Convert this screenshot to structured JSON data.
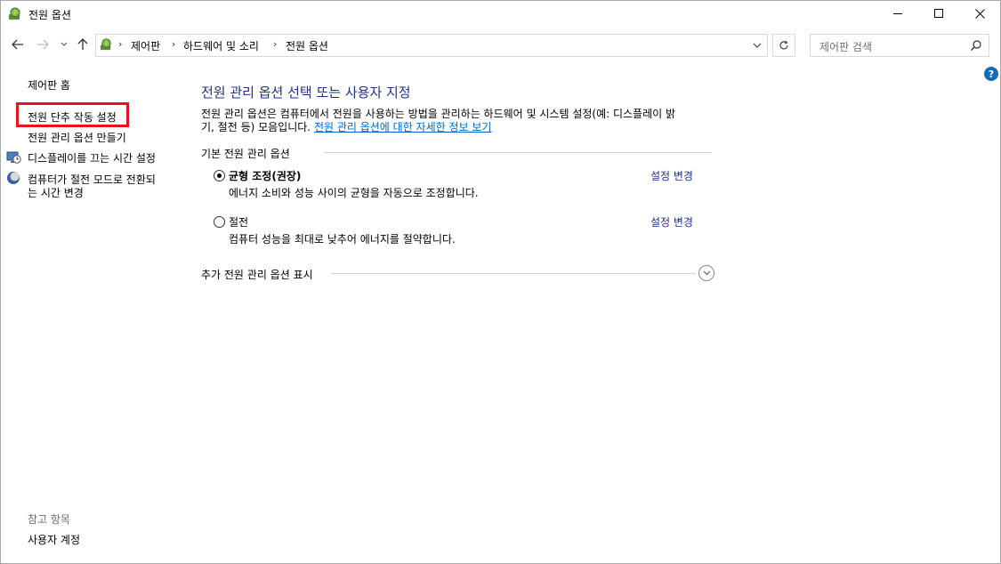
{
  "window": {
    "title": "전원 옵션"
  },
  "nav": {
    "breadcrumb": [
      "제어판",
      "하드웨어 및 소리",
      "전원 옵션"
    ],
    "search_placeholder": "제어판 검색"
  },
  "sidebar": {
    "home": "제어판 홈",
    "links": [
      "전원 단추 작동 설정",
      "전원 관리 옵션 만들기",
      "디스플레이를 끄는 시간 설정",
      "컴퓨터가 절전 모드로 전환되",
      "는 시간 변경"
    ],
    "see_also_heading": "참고 항목",
    "see_also_links": [
      "사용자 계정"
    ]
  },
  "main": {
    "heading": "전원 관리 옵션 선택 또는 사용자 지정",
    "description_line1": "전원 관리 옵션은 컴퓨터에서 전원을 사용하는 방법을 관리하는 하드웨어 및 시스템 설정(예: 디스플레이 밝",
    "description_line2": "기, 절전 등) 모음입니다. ",
    "description_link": "전원 관리 옵션에 대한 자세한 정보 보기",
    "group_label": "기본 전원 관리 옵션",
    "plans": [
      {
        "name": "균형 조정(권장)",
        "description": "에너지 소비와 성능 사이의 균형을 자동으로 조정합니다.",
        "link": "설정 변경",
        "selected": true
      },
      {
        "name": "절전",
        "description": "컴퓨터 성능을 최대로 낮추어 에너지를 절약합니다.",
        "link": "설정 변경",
        "selected": false
      }
    ],
    "more_label": "추가 전원 관리 옵션 표시"
  },
  "help_label": "?"
}
